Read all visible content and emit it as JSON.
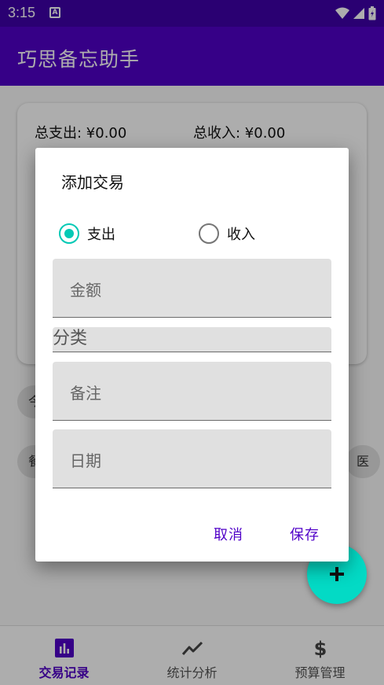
{
  "status_bar": {
    "time": "3:15",
    "notification_icon": "font-download-icon"
  },
  "app_bar": {
    "title": "巧思备忘助手"
  },
  "summary": {
    "expense": "总支出: ¥0.00",
    "income": "总收入: ¥0.00"
  },
  "chips": {
    "row1_left": "今",
    "row2_left": "餐",
    "row2_right": "医"
  },
  "dialog": {
    "title": "添加交易",
    "type_options": [
      {
        "label": "支出",
        "checked": true
      },
      {
        "label": "收入",
        "checked": false
      }
    ],
    "fields": {
      "amount_placeholder": "金额",
      "category_label": "分类",
      "note_placeholder": "备注",
      "date_placeholder": "日期"
    },
    "cancel_label": "取消",
    "save_label": "保存"
  },
  "bottom_nav": {
    "items": [
      {
        "label": "交易记录",
        "icon": "bar-chart-icon",
        "active": true
      },
      {
        "label": "统计分析",
        "icon": "trending-icon",
        "active": false
      },
      {
        "label": "预算管理",
        "icon": "dollar-icon",
        "active": false
      }
    ]
  },
  "colors": {
    "primary": "#5000c8",
    "accent": "#03dac5",
    "status_bar": "#3f00a8"
  }
}
